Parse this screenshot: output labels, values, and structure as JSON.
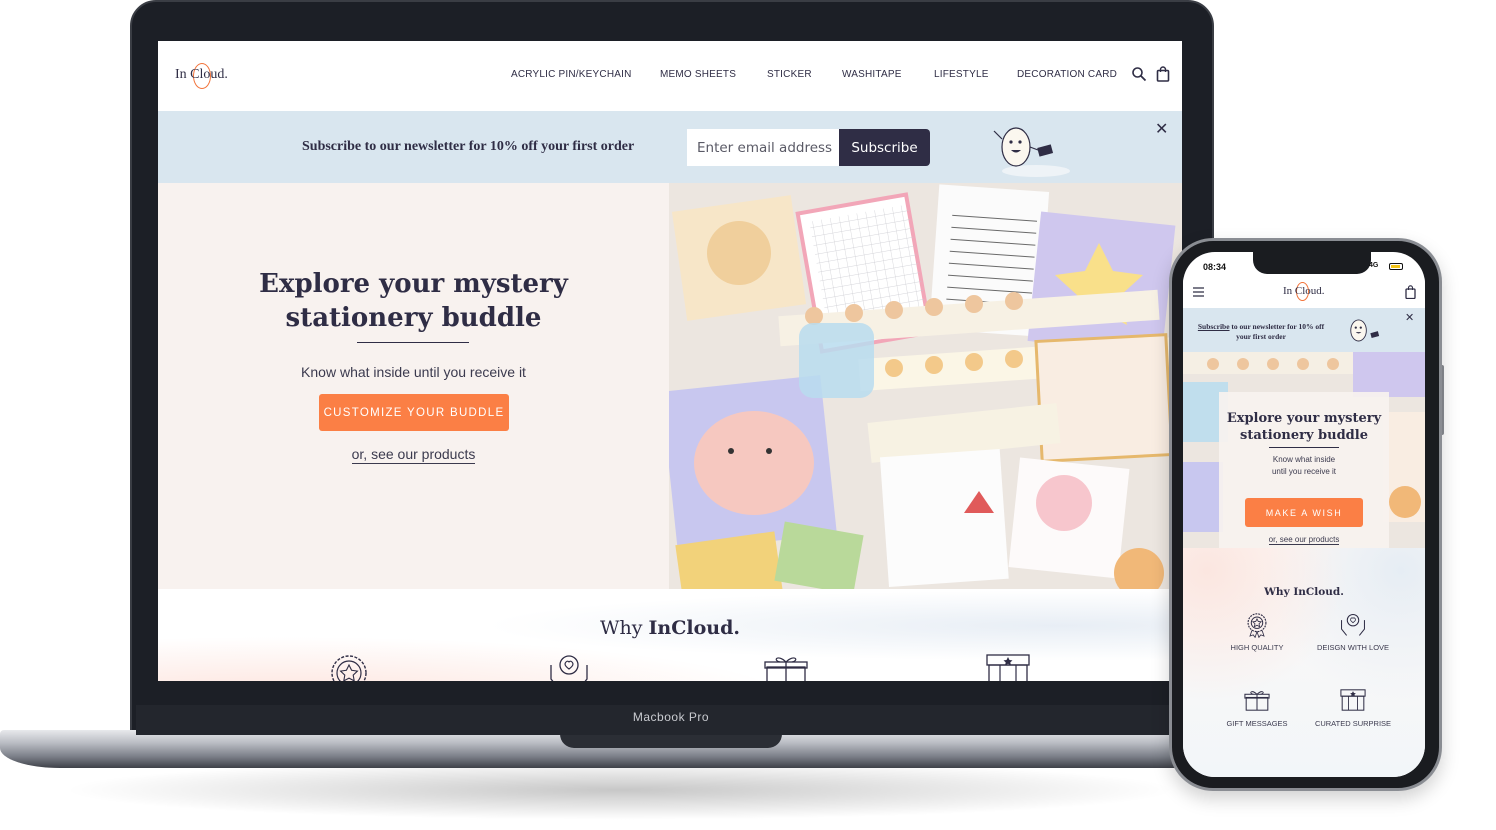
{
  "desktop": {
    "device_label": "Macbook Pro",
    "header": {
      "logo": "In Cloud.",
      "nav": [
        "ACRYLIC PIN/KEYCHAIN",
        "MEMO SHEETS",
        "STICKER",
        "WASHITAPE",
        "LIFESTYLE",
        "DECORATION CARD"
      ],
      "icons": [
        "search-icon",
        "bag-icon"
      ]
    },
    "newsletter": {
      "text": "Subscribe to our newsletter for 10% off your first order",
      "placeholder": "Enter email address",
      "button": "Subscribe",
      "close": "✕"
    },
    "hero": {
      "title_line1": "Explore your mystery",
      "title_line2": "stationery buddle",
      "subtitle": "Know what inside until you receive it",
      "cta": "CUSTOMIZE YOUR BUDDLE",
      "link": "or, see our products"
    },
    "why": {
      "title_prefix": "Why ",
      "title_brand": "InCloud."
    }
  },
  "mobile": {
    "status": {
      "time": "08:34",
      "network": "4G"
    },
    "header": {
      "logo": "In Cloud."
    },
    "newsletter": {
      "link": "Subscribe",
      "text": " to our newsletter for 10% off your first order",
      "close": "✕"
    },
    "hero": {
      "title_line1": "Explore your mystery",
      "title_line2": "stationery buddle",
      "subtitle_line1": "Know what inside",
      "subtitle_line2": "until you receive it",
      "cta": "MAKE A WISH",
      "link": "or, see our products"
    },
    "why": {
      "title": "Why InCloud.",
      "features": [
        {
          "label": "HIGH QUALITY",
          "icon": "award-badge-icon"
        },
        {
          "label": "DEISGN WITH LOVE",
          "icon": "heart-hands-icon"
        },
        {
          "label": "GIFT MESSAGES",
          "icon": "gift-box-icon"
        },
        {
          "label": "CURATED SURPRISE",
          "icon": "surprise-box-icon"
        }
      ]
    }
  },
  "colors": {
    "navy": "#2f2d45",
    "accent_orange": "#fb7f45",
    "newsletter_bg": "#d9e6ef",
    "hero_bg": "#f8f2ef"
  }
}
